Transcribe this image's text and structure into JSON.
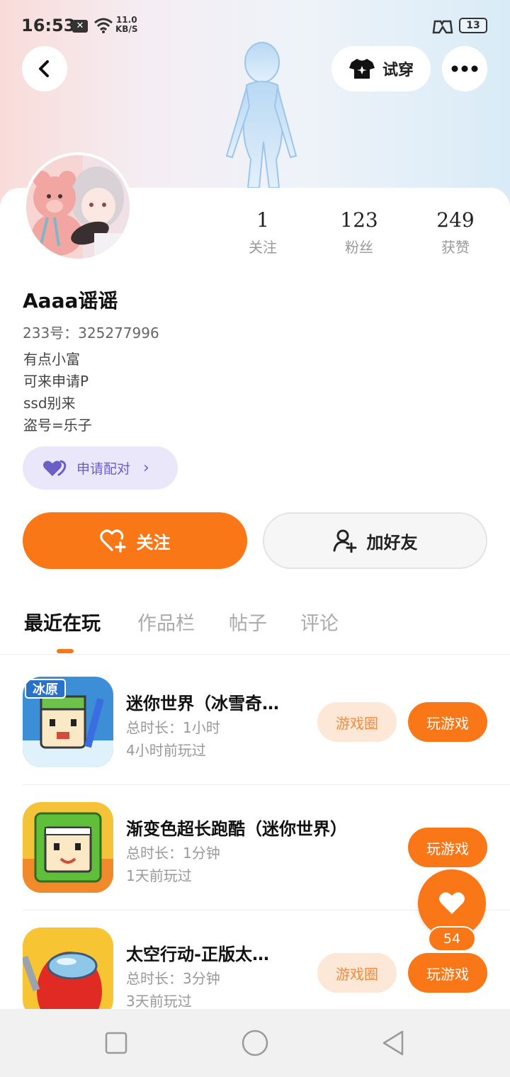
{
  "status_bar": {
    "time": "16:53",
    "notif_icon": "x-box-icon",
    "net_speed_value": "11.0",
    "net_speed_unit": "KB/S",
    "battery": "13"
  },
  "header": {
    "try_on_label": "试穿",
    "icons": [
      "back-arrow-icon",
      "tshirt-icon",
      "more-dots-icon"
    ]
  },
  "profile": {
    "stats": [
      {
        "value": "1",
        "label": "关注"
      },
      {
        "value": "123",
        "label": "粉丝"
      },
      {
        "value": "249",
        "label": "获赞"
      }
    ],
    "username": "Aaaa谣谣",
    "uid": "233号：325277996",
    "bio": [
      "有点小富",
      "可来申请P",
      "ssd别来",
      "盗号=乐子"
    ],
    "pair_label": "申请配对",
    "follow_label": "关注",
    "add_friend_label": "加好友"
  },
  "tabs": [
    {
      "label": "最近在玩",
      "active": true
    },
    {
      "label": "作品栏",
      "active": false
    },
    {
      "label": "帖子",
      "active": false
    },
    {
      "label": "评论",
      "active": false
    }
  ],
  "games": [
    {
      "title": "迷你世界（冰雪奇…",
      "duration": "总时长：1小时",
      "last_played": "4小时前玩过",
      "circle_label": "游戏圈",
      "play_label": "玩游戏",
      "icon_badge": "冰原"
    },
    {
      "title": "渐变色超长跑酷（迷你世界）",
      "duration": "总时长：1分钟",
      "last_played": "1天前玩过",
      "play_label": "玩游戏"
    },
    {
      "title": "太空行动-正版太…",
      "duration": "总时长：3分钟",
      "last_played": "3天前玩过",
      "circle_label": "游戏圈",
      "play_label": "玩游戏"
    }
  ],
  "like": {
    "count": "54"
  },
  "colors": {
    "accent": "#f97716",
    "pair_bg": "#e9e7f9",
    "pair_text": "#6b5fc7"
  }
}
